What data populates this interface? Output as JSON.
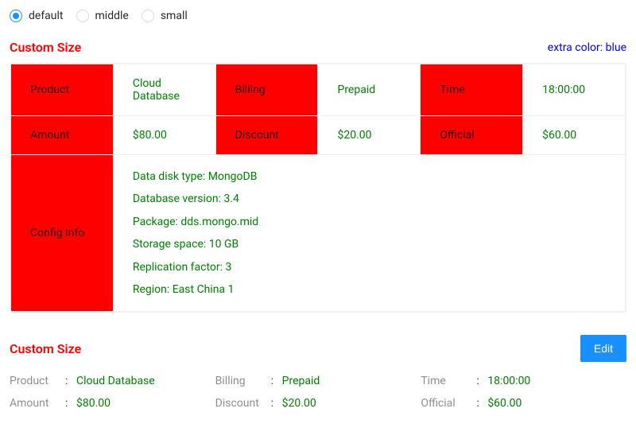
{
  "sizeOptions": {
    "default": "default",
    "middle": "middle",
    "small": "small",
    "selected": "default"
  },
  "desc1": {
    "title": "Custom Size",
    "extra": "extra color: blue",
    "labels": {
      "product": "Product",
      "billing": "Billing",
      "time": "Time",
      "amount": "Amount",
      "discount": "Discount",
      "official": "Official",
      "config": "Config Info"
    },
    "values": {
      "product": "Cloud Database",
      "billing": "Prepaid",
      "time": "18:00:00",
      "amount": "$80.00",
      "discount": "$20.00",
      "official": "$60.00"
    },
    "config": {
      "dataDisk": "Data disk type: MongoDB",
      "dbVersion": "Database version: 3.4",
      "package": "Package: dds.mongo.mid",
      "storage": "Storage space: 10 GB",
      "replication": "Replication factor: 3",
      "region": "Region: East China 1"
    }
  },
  "desc2": {
    "title": "Custom Size",
    "editLabel": "Edit",
    "labels": {
      "product": "Product",
      "billing": "Billing",
      "time": "Time",
      "amount": "Amount",
      "discount": "Discount",
      "official": "Official"
    },
    "values": {
      "product": "Cloud Database",
      "billing": "Prepaid",
      "time": "18:00:00",
      "amount": "$80.00",
      "discount": "$20.00",
      "official": "$60.00"
    }
  }
}
